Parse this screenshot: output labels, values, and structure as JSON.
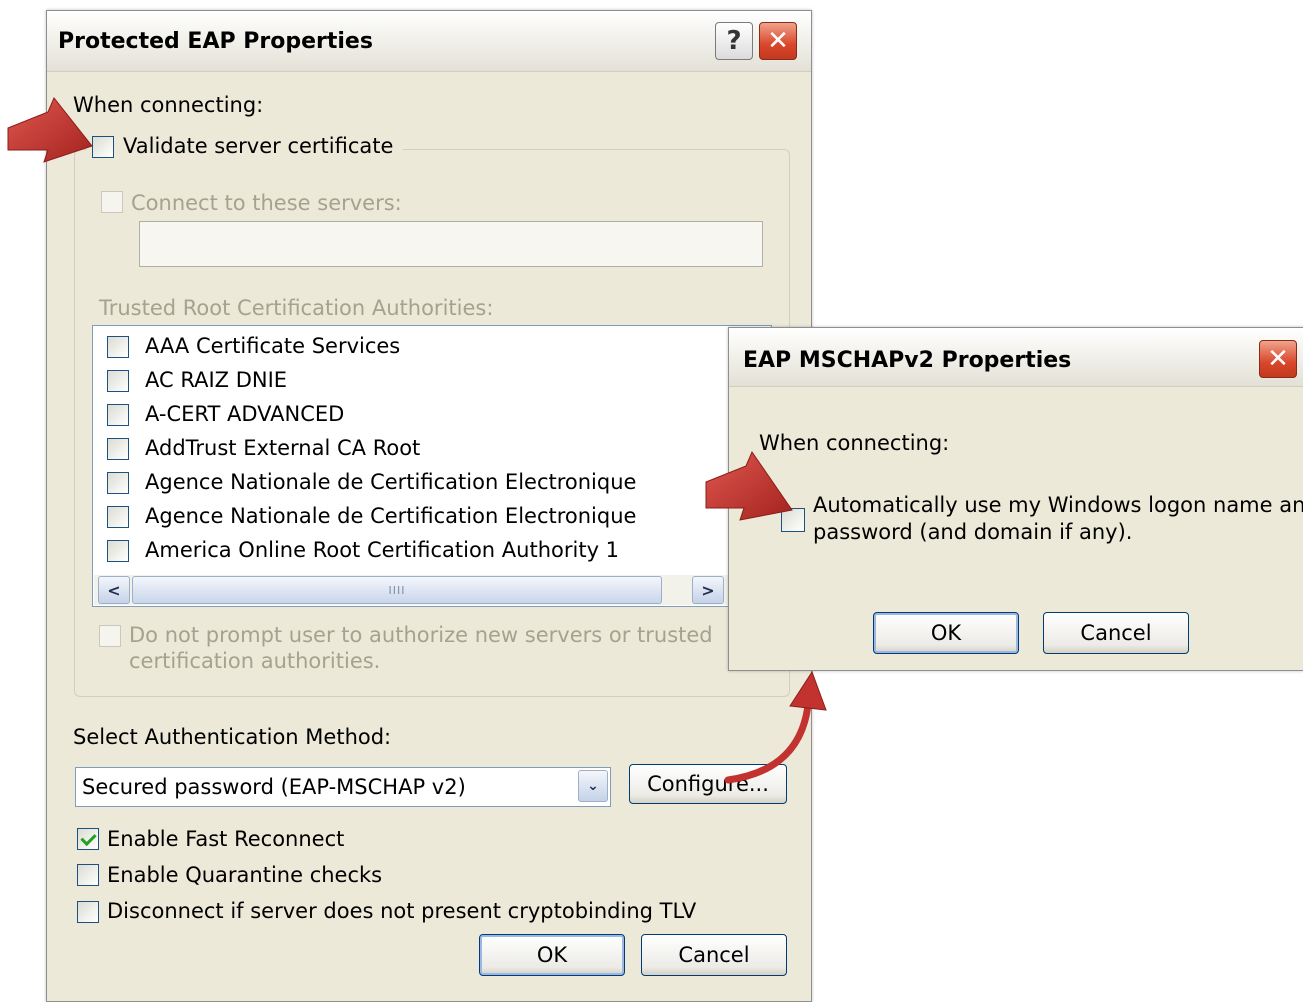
{
  "peap_dialog": {
    "title": "Protected EAP Properties",
    "help_button": "?",
    "close_button": "✕",
    "when_connecting_label": "When connecting:",
    "validate_cert_label": "Validate server certificate",
    "connect_servers_label": "Connect to these servers:",
    "servers_value": "",
    "trusted_root_label": "Trusted Root Certification Authorities:",
    "ca_list": [
      {
        "label": "AAA Certificate Services",
        "checked": false
      },
      {
        "label": "AC RAIZ DNIE",
        "checked": false
      },
      {
        "label": "A-CERT ADVANCED",
        "checked": false
      },
      {
        "label": "AddTrust External CA Root",
        "checked": false
      },
      {
        "label": "Agence Nationale de Certification Electronique",
        "checked": false
      },
      {
        "label": "Agence Nationale de Certification Electronique",
        "checked": false
      },
      {
        "label": "America Online Root Certification Authority 1",
        "checked": false
      }
    ],
    "scroll_left": "<",
    "scroll_right": ">",
    "scroll_thumb_grip": "IIII",
    "no_prompt_line1": "Do not prompt user to authorize new servers or trusted",
    "no_prompt_line2": "certification authorities.",
    "select_auth_label": "Select Authentication Method:",
    "auth_method_value": "Secured password (EAP-MSCHAP v2)",
    "dropdown_arrow": "⌄",
    "configure_button": "Configure...",
    "enable_fast_reconnect_label": "Enable Fast Reconnect",
    "enable_fast_reconnect_checked": true,
    "enable_quarantine_label": "Enable Quarantine checks",
    "enable_quarantine_checked": false,
    "disconnect_crypto_label": "Disconnect if server does not present cryptobinding TLV",
    "disconnect_crypto_checked": false,
    "ok_button": "OK",
    "cancel_button": "Cancel"
  },
  "mschap_dialog": {
    "title": "EAP MSCHAPv2 Properties",
    "close_button": "✕",
    "when_connecting_label": "When connecting:",
    "auto_logon_line1": "Automatically use my Windows logon name and",
    "auto_logon_line2": "password (and domain if any).",
    "auto_logon_checked": false,
    "ok_button": "OK",
    "cancel_button": "Cancel"
  },
  "colors": {
    "dialog_bg": "#ece9d8",
    "annotation_arrow": "#c2332f",
    "checkbox_border": "#1c5180",
    "check_mark": "#21a121",
    "close_button": "#d9462b"
  },
  "icons": {
    "annotation": "red-arrow-icon",
    "help": "help-icon",
    "close": "close-icon",
    "check": "checkmark-icon",
    "dropdown": "chevron-down-icon"
  }
}
